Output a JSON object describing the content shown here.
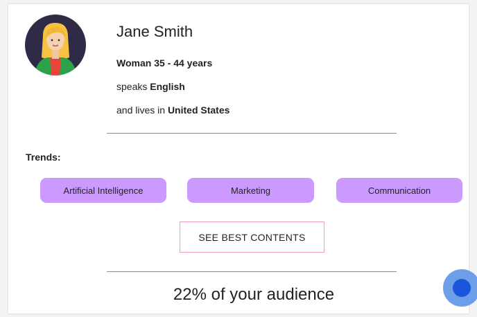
{
  "profile": {
    "name": "Jane Smith",
    "demographics": "Woman 35 - 44 years",
    "speaks_prefix": "speaks ",
    "language": "English",
    "lives_prefix": "and lives in ",
    "country": "United States",
    "avatar_icon": "woman-avatar-icon"
  },
  "trends": {
    "label": "Trends:",
    "items": [
      {
        "label": "Artificial Intelligence"
      },
      {
        "label": "Marketing"
      },
      {
        "label": "Communication"
      }
    ]
  },
  "cta": {
    "label": "SEE BEST CONTENTS"
  },
  "audience": {
    "text": "22% of your audience"
  },
  "colors": {
    "chip_bg": "#cc99ff",
    "cta_border": "#f29bb4",
    "fab_outer": "#6d9ee8",
    "fab_inner": "#1a56db",
    "avatar_bg": "#2f2b47"
  }
}
